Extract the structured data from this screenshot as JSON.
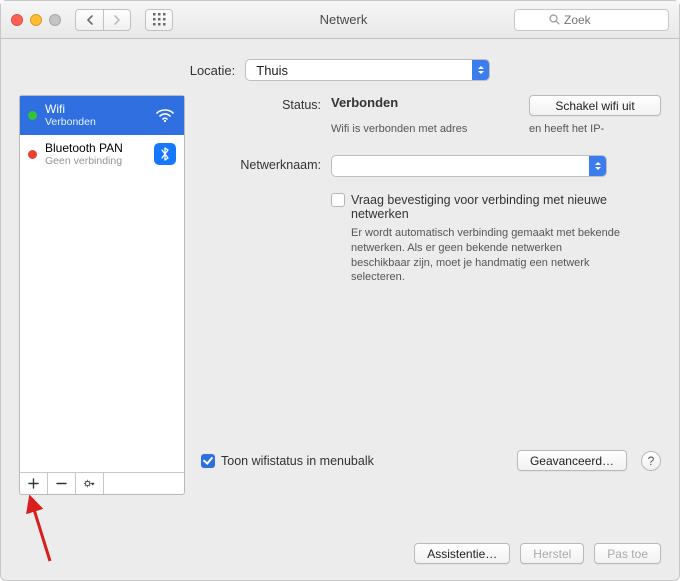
{
  "window": {
    "title": "Netwerk",
    "search_placeholder": "Zoek"
  },
  "location": {
    "label": "Locatie:",
    "value": "Thuis"
  },
  "services": [
    {
      "name": "Wifi",
      "status": "Verbonden",
      "dot": "green",
      "selected": true,
      "icon": "wifi"
    },
    {
      "name": "Bluetooth PAN",
      "status": "Geen verbinding",
      "dot": "red",
      "selected": false,
      "icon": "bluetooth"
    }
  ],
  "detail": {
    "status_label": "Status:",
    "status_value": "Verbonden",
    "toggle_button": "Schakel wifi uit",
    "status_hint_left": "Wifi is verbonden met adres",
    "status_hint_right": "en heeft het IP-",
    "network_name_label": "Netwerknaam:",
    "network_name_value": "",
    "ask_join_checkbox": "Vraag bevestiging voor verbinding met nieuwe netwerken",
    "ask_join_hint": "Er wordt automatisch verbinding gemaakt met bekende netwerken. Als er geen bekende netwerken beschikbaar zijn, moet je handmatig een netwerk selecteren.",
    "show_menubar": "Toon wifistatus in menubalk",
    "advanced_button": "Geavanceerd…",
    "help_glyph": "?"
  },
  "footer_buttons": {
    "assist": "Assistentie…",
    "revert": "Herstel",
    "apply": "Pas toe"
  }
}
